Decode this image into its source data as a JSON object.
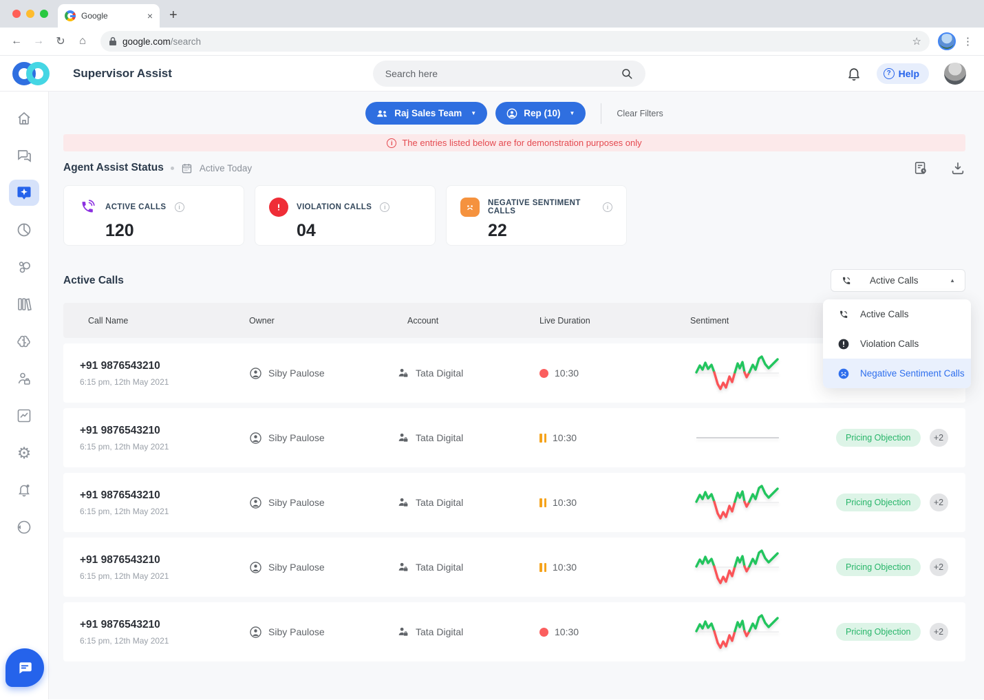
{
  "browser": {
    "tab_title": "Google",
    "url_host": "google.com",
    "url_path": "/search",
    "new_tab_label": "+",
    "close_tab_label": "×"
  },
  "header": {
    "app_title": "Supervisor Assist",
    "search_placeholder": "Search here",
    "help_label": "Help"
  },
  "sidebar": {
    "items": [
      {
        "icon": "home-icon"
      },
      {
        "icon": "conversations-icon"
      },
      {
        "icon": "agent-assist-sparkle-icon",
        "active": true
      },
      {
        "icon": "pie-chart-icon"
      },
      {
        "icon": "circles-cluster-icon"
      },
      {
        "icon": "library-icon"
      },
      {
        "icon": "brain-icon"
      },
      {
        "icon": "user-management-icon"
      },
      {
        "icon": "analytics-icon"
      },
      {
        "icon": "settings-gear-icon"
      },
      {
        "icon": "notifications-bell-icon"
      },
      {
        "icon": "logout-icon"
      }
    ],
    "fab_icon": "chat-widget-icon"
  },
  "filters": {
    "team_label": "Raj Sales Team",
    "rep_label": "Rep (10)",
    "clear_label": "Clear Filters"
  },
  "banner": {
    "text": "The entries listed below are for demonstration purposes only"
  },
  "status": {
    "title": "Agent Assist Status",
    "period": "Active Today",
    "cards": [
      {
        "label": "ACTIVE CALLS",
        "value": "120",
        "icon": "phone-icon",
        "color": "#8b2fe0"
      },
      {
        "label": "VIOLATION CALLS",
        "value": "04",
        "icon": "alert-icon",
        "color": "#ef2d37"
      },
      {
        "label": "NEGATIVE SENTIMENT CALLS",
        "value": "22",
        "icon": "sad-face-icon",
        "color": "#f5923e"
      }
    ]
  },
  "table_section": {
    "title": "Active Calls",
    "dropdown": {
      "selected": "Active Calls",
      "options": [
        {
          "label": "Active Calls",
          "icon": "phone-icon"
        },
        {
          "label": "Violation Calls",
          "icon": "alert-icon"
        },
        {
          "label": "Negative Sentiment Calls",
          "icon": "sad-face-icon",
          "highlighted": true
        }
      ]
    },
    "columns": [
      "Call Name",
      "Owner",
      "Account",
      "Live Duration",
      "Sentiment"
    ],
    "rows": [
      {
        "call_name": "+91 9876543210",
        "datetime": "6:15 pm, 12th May 2021",
        "owner": "Siby Paulose",
        "account": "Tata Digital",
        "duration": "10:30",
        "status": "live",
        "sentiment": "chart",
        "tags": [],
        "more": ""
      },
      {
        "call_name": "+91 9876543210",
        "datetime": "6:15 pm, 12th May 2021",
        "owner": "Siby Paulose",
        "account": "Tata Digital",
        "duration": "10:30",
        "status": "paused",
        "sentiment": "flat",
        "tags": [
          "Pricing Objection"
        ],
        "more": "+2"
      },
      {
        "call_name": "+91 9876543210",
        "datetime": "6:15 pm, 12th May 2021",
        "owner": "Siby Paulose",
        "account": "Tata Digital",
        "duration": "10:30",
        "status": "paused",
        "sentiment": "chart",
        "tags": [
          "Pricing Objection"
        ],
        "more": "+2"
      },
      {
        "call_name": "+91 9876543210",
        "datetime": "6:15 pm, 12th May 2021",
        "owner": "Siby Paulose",
        "account": "Tata Digital",
        "duration": "10:30",
        "status": "paused",
        "sentiment": "chart",
        "tags": [
          "Pricing Objection"
        ],
        "more": "+2"
      },
      {
        "call_name": "+91 9876543210",
        "datetime": "6:15 pm, 12th May 2021",
        "owner": "Siby Paulose",
        "account": "Tata Digital",
        "duration": "10:30",
        "status": "live",
        "sentiment": "chart",
        "tags": [
          "Pricing Objection"
        ],
        "more": "+2"
      }
    ]
  },
  "colors": {
    "accent_blue": "#2f6fe0",
    "banner_red": "#e4494f",
    "sentiment_green": "#22c55e",
    "sentiment_red": "#fb5458",
    "pause_orange": "#f5a31c",
    "tag_green": "#27b569"
  }
}
